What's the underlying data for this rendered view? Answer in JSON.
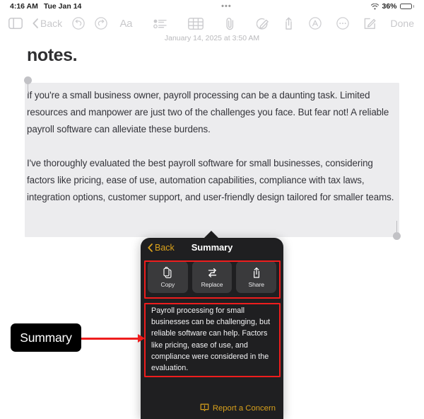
{
  "statusbar": {
    "time": "4:16 AM",
    "date": "Tue Jan 14",
    "center_dots": "•••",
    "battery_percent": "36%",
    "wifi_icon": "wifi-icon",
    "battery_icon": "battery-icon"
  },
  "toolbar": {
    "sidebar_icon": "sidebar-toggle-icon",
    "back_label": "Back",
    "back_icon": "chevron-left-icon",
    "undo_icon": "undo-icon",
    "redo_icon": "redo-icon",
    "format_label": "Aa",
    "checklist_icon": "checklist-icon",
    "table_icon": "table-icon",
    "attachment_icon": "paperclip-icon",
    "markup_icon": "markup-pen-icon",
    "share_icon": "share-icon",
    "intelligence_icon": "apple-intelligence-icon",
    "more_icon": "more-ellipsis-icon",
    "compose_icon": "compose-icon",
    "done_label": "Done"
  },
  "note": {
    "datestamp": "January 14, 2025 at 3:50 AM",
    "title": "notes.",
    "paragraph1": "If you're a small business owner, payroll processing can be a daunting task. Limited resources and manpower are just two of the challenges you face. But fear not! A reliable payroll software can alleviate these burdens.",
    "paragraph2": "I've thoroughly evaluated the best payroll software for small businesses, considering factors like pricing, ease of use, automation capabilities, compliance with tax laws, integration options, customer support, and user-friendly design tailored for smaller teams."
  },
  "popover": {
    "back_label": "Back",
    "back_icon": "chevron-left-icon",
    "title": "Summary",
    "actions": [
      {
        "label": "Copy",
        "icon": "copy-icon"
      },
      {
        "label": "Replace",
        "icon": "replace-arrows-icon"
      },
      {
        "label": "Share",
        "icon": "share-icon"
      }
    ],
    "summary_text": "Payroll processing for small businesses can be challenging, but reliable software can help.  Factors like pricing, ease of use, and compliance were considered in the evaluation.",
    "report_label": "Report a Concern",
    "report_icon": "report-concern-icon"
  },
  "annotation": {
    "callout_label": "Summary",
    "highlight_color": "#ee1d1d",
    "accent_color": "#d9a11c"
  }
}
